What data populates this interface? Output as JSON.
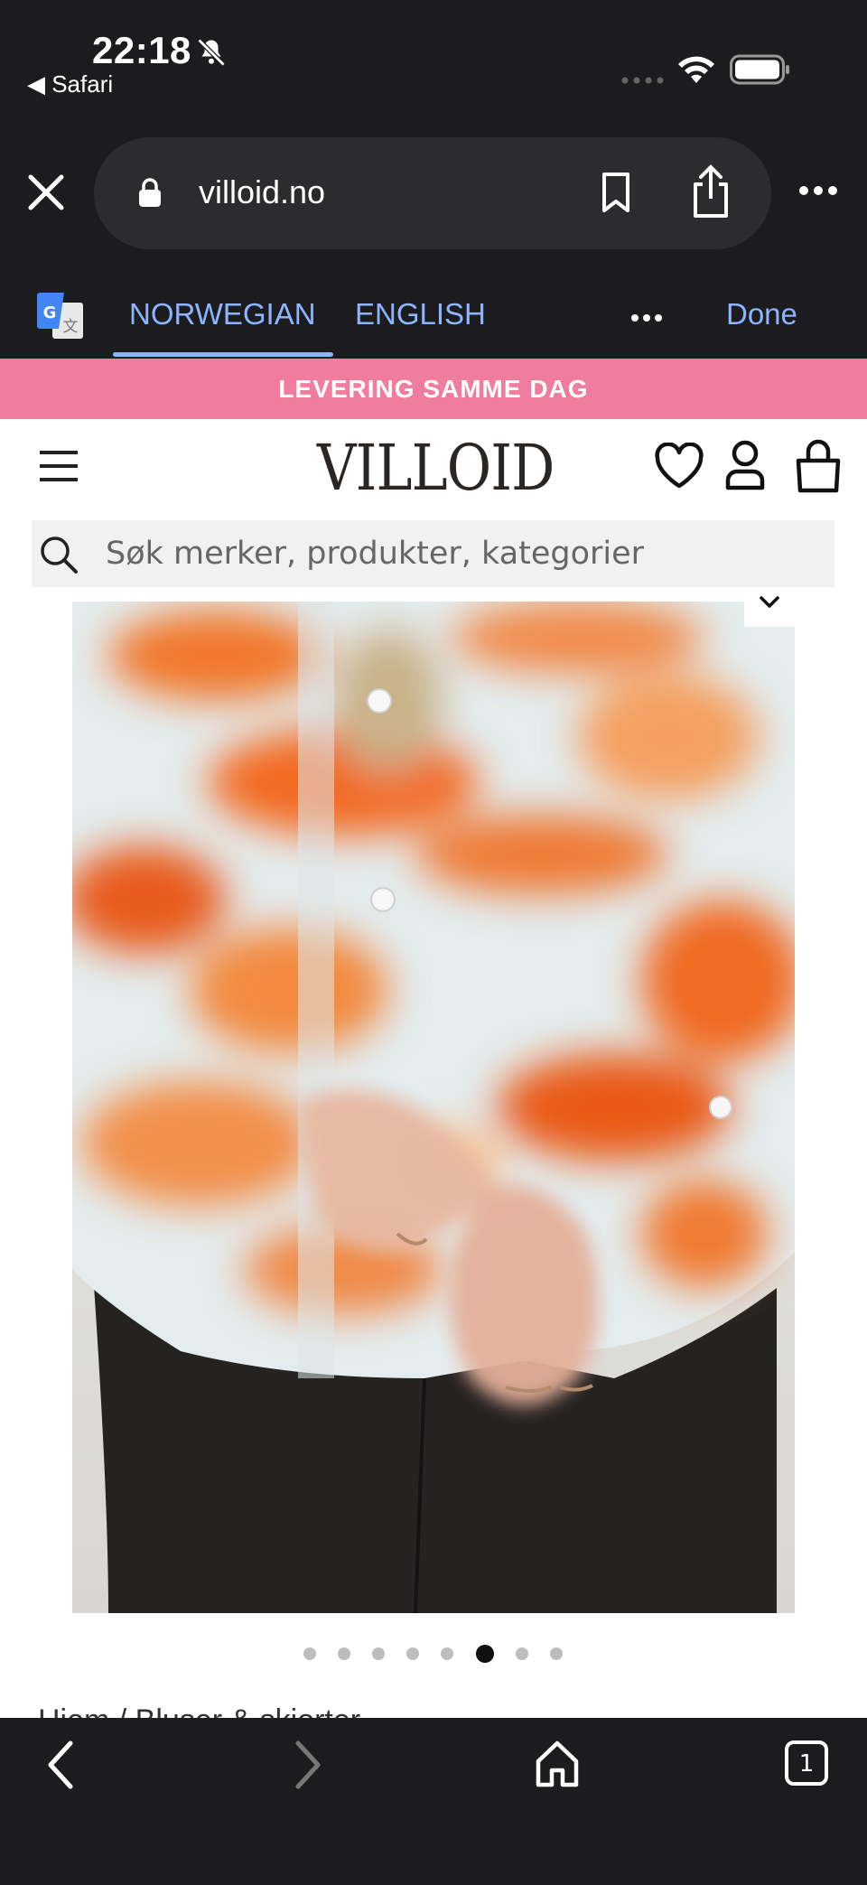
{
  "status_bar": {
    "time": "22:18",
    "back_app": "◀ Safari"
  },
  "browser": {
    "url": "villoid.no"
  },
  "translate_bar": {
    "lang_source": "NORWEGIAN",
    "lang_target": "ENGLISH",
    "done_label": "Done"
  },
  "promo": {
    "text": "LEVERING SAMME DAG"
  },
  "header": {
    "logo": "VILLOID"
  },
  "search": {
    "placeholder": "Søk merker, produkter, kategorier"
  },
  "product": {
    "image_alt": "Orange and white abstract print satin shirt",
    "carousel_count": 8,
    "carousel_active_index": 5
  },
  "breadcrumb": {
    "text": "Hjem / Bluser & skjorter"
  },
  "colors": {
    "dark_chrome": "#1c1c1e",
    "accent_link": "#8cb4ff",
    "promo_bg": "#f07d9e"
  },
  "icons": [
    "bell-slash-icon",
    "wifi-icon",
    "battery-icon",
    "close-icon",
    "lock-icon",
    "bookmark-icon",
    "share-icon",
    "more-icon",
    "google-translate-icon",
    "menu-icon",
    "heart-icon",
    "user-icon",
    "bag-icon",
    "search-icon",
    "chevron-down-icon",
    "back-icon",
    "forward-icon",
    "home-icon",
    "tabs-icon"
  ]
}
